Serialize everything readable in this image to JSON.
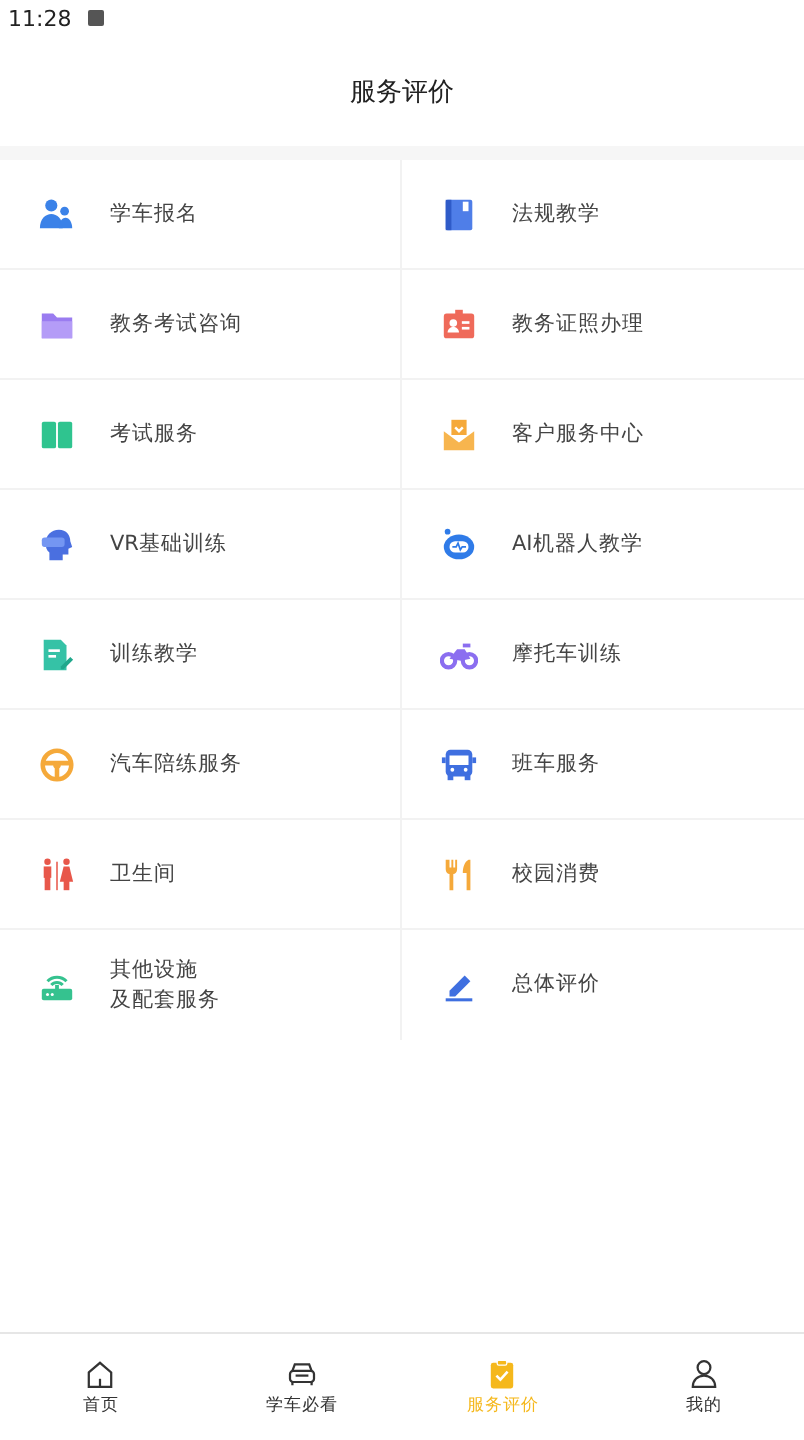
{
  "status_bar": {
    "time": "11:28"
  },
  "header": {
    "title": "服务评价"
  },
  "services": [
    {
      "label": "学车报名",
      "kind": "people"
    },
    {
      "label": "法规教学",
      "kind": "book"
    },
    {
      "label": "教务考试咨询",
      "kind": "folder"
    },
    {
      "label": "教务证照办理",
      "kind": "id-card"
    },
    {
      "label": "考试服务",
      "kind": "open-book"
    },
    {
      "label": "客户服务中心",
      "kind": "mail"
    },
    {
      "label": "VR基础训练",
      "kind": "vr-head"
    },
    {
      "label": "AI机器人教学",
      "kind": "robot"
    },
    {
      "label": "训练教学",
      "kind": "note-edit"
    },
    {
      "label": "摩托车训练",
      "kind": "motorcycle"
    },
    {
      "label": "汽车陪练服务",
      "kind": "steering-wheel"
    },
    {
      "label": "班车服务",
      "kind": "bus"
    },
    {
      "label": "卫生间",
      "kind": "restroom"
    },
    {
      "label": "校园消费",
      "kind": "cutlery"
    },
    {
      "lines": [
        "其他设施",
        "及配套服务"
      ],
      "kind": "router"
    },
    {
      "label": "总体评价",
      "kind": "pen"
    }
  ],
  "bottom_nav": [
    {
      "label": "首页",
      "kind": "home",
      "selected": false
    },
    {
      "label": "学车必看",
      "kind": "car",
      "selected": false
    },
    {
      "label": "服务评价",
      "kind": "clipboard",
      "selected": true
    },
    {
      "label": "我的",
      "kind": "person",
      "selected": false
    }
  ]
}
